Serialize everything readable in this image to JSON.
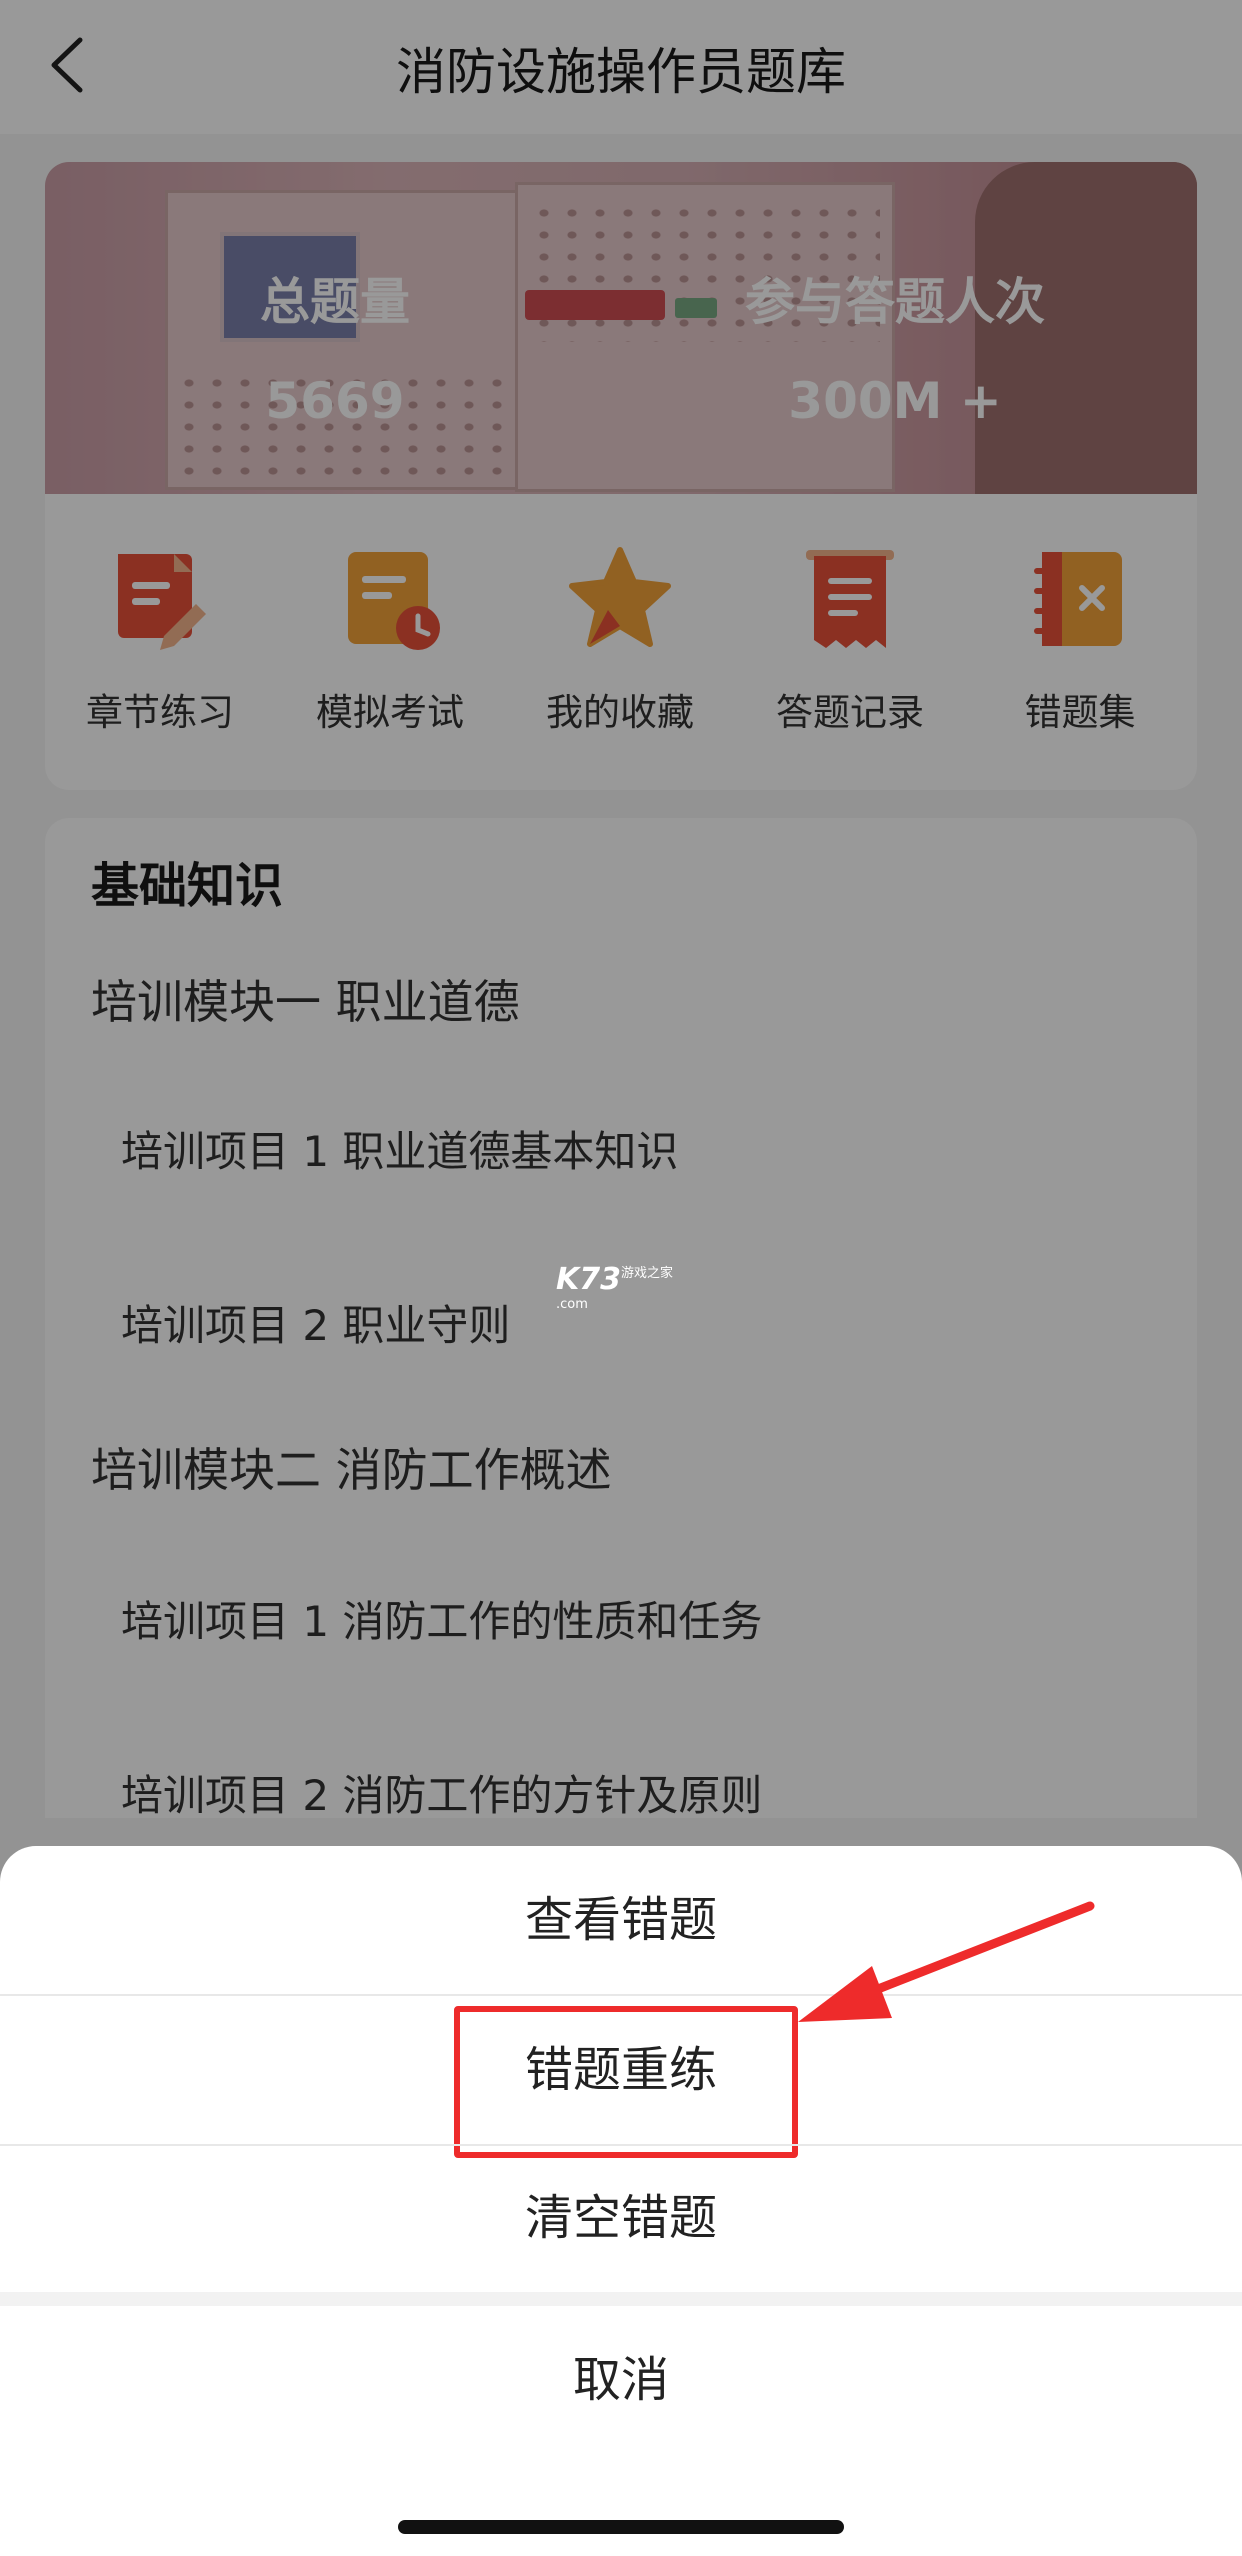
{
  "header": {
    "title": "消防设施操作员题库",
    "back_icon": "chevron-left-icon"
  },
  "banner": {
    "stats": [
      {
        "label": "总题量",
        "value": "5669"
      },
      {
        "label": "参与答题人次",
        "value": "300M +"
      }
    ]
  },
  "shortcuts": [
    {
      "label": "章节练习",
      "icon": "pencil-note-icon",
      "color": "#e8503a"
    },
    {
      "label": "模拟考试",
      "icon": "exam-clock-icon",
      "color": "#f2a23a"
    },
    {
      "label": "我的收藏",
      "icon": "star-icon",
      "color": "#f2a23a"
    },
    {
      "label": "答题记录",
      "icon": "receipt-icon",
      "color": "#e8503a"
    },
    {
      "label": "错题集",
      "icon": "notebook-x-icon",
      "color": "#f2a23a"
    }
  ],
  "knowledge": {
    "title": "基础知识",
    "modules": [
      {
        "title": "培训模块一 职业道德",
        "items": [
          "培训项目 1 职业道德基本知识",
          "培训项目 2 职业守则"
        ]
      },
      {
        "title": "培训模块二 消防工作概述",
        "items": [
          "培训项目 1 消防工作的性质和任务",
          "培训项目 2 消防工作的方针及原则"
        ]
      }
    ]
  },
  "watermark": {
    "brand": "K73",
    "sub1": "游戏之家",
    "sub2": ".com"
  },
  "action_sheet": {
    "options": [
      "查看错题",
      "错题重练",
      "清空错题"
    ],
    "cancel": "取消",
    "highlight_color": "#ee2b2b"
  }
}
